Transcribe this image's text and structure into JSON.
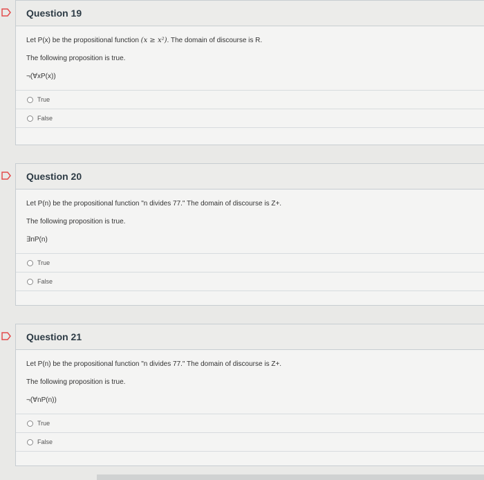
{
  "questions": [
    {
      "title": "Question 19",
      "line1_before": "Let P(x) be the propositional function",
      "line1_math": "(x ≥ x²)",
      "line1_after": ". The domain of discourse is R.",
      "line2": "The following proposition is true.",
      "formula": "¬(∀xP(x))",
      "answers": [
        "True",
        "False"
      ]
    },
    {
      "title": "Question 20",
      "line1_before": "Let P(n) be the propositional function \"n divides 77.\" The domain of discourse is Z+.",
      "line2": "The following proposition is true.",
      "formula": "∃nP(n)",
      "answers": [
        "True",
        "False"
      ]
    },
    {
      "title": "Question 21",
      "line1_before": "Let P(n) be the propositional function \"n divides 77.\" The domain of discourse is Z+.",
      "line2": "The following proposition is true.",
      "formula": "¬(∀nP(n))",
      "answers": [
        "True",
        "False"
      ]
    }
  ],
  "colors": {
    "flag_stroke": "#e34b4b",
    "background": "#e9e9e7"
  }
}
